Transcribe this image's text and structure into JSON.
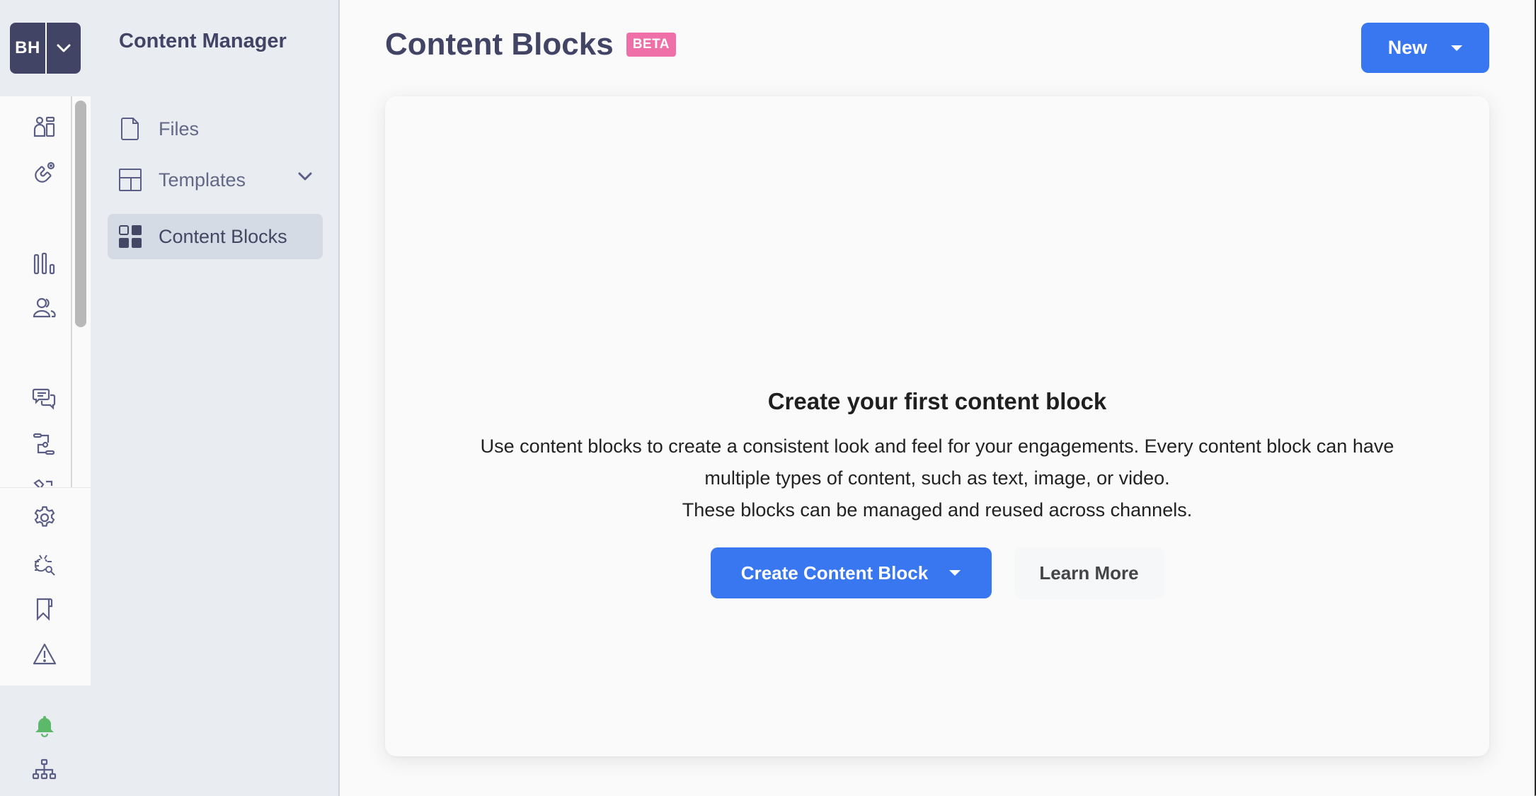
{
  "org_switcher": {
    "initials": "BH",
    "icon": "chevron-down-icon"
  },
  "rail": {
    "items": [
      {
        "name": "dashboard",
        "icon": "dashboard-layout-icon"
      },
      {
        "name": "engagement",
        "icon": "magnet-icon"
      },
      {
        "name": "analytics",
        "icon": "bar-chart-icon"
      },
      {
        "name": "audience",
        "icon": "users-icon"
      },
      {
        "name": "conversations",
        "icon": "chat-bubbles-icon"
      },
      {
        "name": "journeys",
        "icon": "flow-icon"
      },
      {
        "name": "campaigns",
        "icon": "megaphone-icon"
      },
      {
        "name": "settings",
        "icon": "gear-icon"
      },
      {
        "name": "debugger",
        "icon": "bug-search-icon"
      },
      {
        "name": "documentation",
        "icon": "bookmark-icon"
      },
      {
        "name": "alerts",
        "icon": "warning-icon"
      },
      {
        "name": "notifications",
        "icon": "bell-icon"
      },
      {
        "name": "organization",
        "icon": "sitemap-icon"
      }
    ],
    "colors": {
      "icon": "#5b5f85",
      "bell": "#5cb96a",
      "org_button": "#424466"
    }
  },
  "subnav": {
    "title": "Content Manager",
    "items": [
      {
        "label": "Files",
        "icon": "file-icon",
        "active": false
      },
      {
        "label": "Templates",
        "icon": "template-layout-icon",
        "active": false,
        "expandable": true
      },
      {
        "label": "Content Blocks",
        "icon": "blocks-grid-icon",
        "active": true
      }
    ]
  },
  "header": {
    "title": "Content Blocks",
    "badge": "BETA",
    "new_button": "New"
  },
  "empty_state": {
    "title": "Create your first content block",
    "body_line1": "Use content blocks to create a consistent look and feel for your engagements. Every content block can have",
    "body_line2": "multiple types of content, such as text, image, or video.",
    "body_line3": "These blocks can be managed and reused across channels.",
    "primary_button": "Create Content Block",
    "secondary_button": "Learn More"
  },
  "colors": {
    "primary": "#3877f0",
    "badge": "#ef6fa9",
    "heading": "#424466"
  }
}
